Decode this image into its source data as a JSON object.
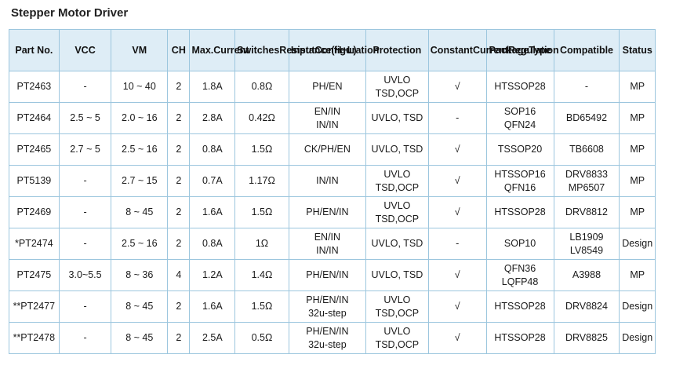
{
  "title": "Stepper Motor Driver",
  "headers": [
    [
      "Part No."
    ],
    [
      "VCC"
    ],
    [
      "VM"
    ],
    [
      "CH"
    ],
    [
      "Max.",
      "Current"
    ],
    [
      "Switches",
      "Resistance",
      "(H+L)"
    ],
    [
      "Input",
      "Configuration"
    ],
    [
      "Protection"
    ],
    [
      "Constant",
      "Current",
      "Regulation"
    ],
    [
      "Package",
      "Type"
    ],
    [
      "Compatible"
    ],
    [
      "Status"
    ]
  ],
  "rows": [
    [
      [
        "PT2463"
      ],
      [
        "-"
      ],
      [
        "10 ~ 40"
      ],
      [
        "2"
      ],
      [
        "1.8A"
      ],
      [
        "0.8Ω"
      ],
      [
        "PH/EN"
      ],
      [
        "UVLO",
        "TSD,OCP"
      ],
      [
        "√"
      ],
      [
        "HTSSOP28"
      ],
      [
        "-"
      ],
      [
        "MP"
      ]
    ],
    [
      [
        "PT2464"
      ],
      [
        "2.5 ~ 5"
      ],
      [
        "2.0 ~ 16"
      ],
      [
        "2"
      ],
      [
        "2.8A"
      ],
      [
        "0.42Ω"
      ],
      [
        "EN/IN",
        "IN/IN"
      ],
      [
        "UVLO, TSD"
      ],
      [
        "-"
      ],
      [
        "SOP16",
        "QFN24"
      ],
      [
        "BD65492"
      ],
      [
        "MP"
      ]
    ],
    [
      [
        "PT2465"
      ],
      [
        "2.7 ~ 5"
      ],
      [
        "2.5 ~ 16"
      ],
      [
        "2"
      ],
      [
        "0.8A"
      ],
      [
        "1.5Ω"
      ],
      [
        "CK/PH/EN"
      ],
      [
        "UVLO, TSD"
      ],
      [
        "√"
      ],
      [
        "TSSOP20"
      ],
      [
        "TB6608"
      ],
      [
        "MP"
      ]
    ],
    [
      [
        "PT5139"
      ],
      [
        "-"
      ],
      [
        "2.7 ~ 15"
      ],
      [
        "2"
      ],
      [
        "0.7A"
      ],
      [
        "1.17Ω"
      ],
      [
        "IN/IN"
      ],
      [
        "UVLO",
        "TSD,OCP"
      ],
      [
        "√"
      ],
      [
        "HTSSOP16",
        "QFN16"
      ],
      [
        "DRV8833",
        "MP6507"
      ],
      [
        "MP"
      ]
    ],
    [
      [
        "PT2469"
      ],
      [
        "-"
      ],
      [
        "8 ~ 45"
      ],
      [
        "2"
      ],
      [
        "1.6A"
      ],
      [
        "1.5Ω"
      ],
      [
        "PH/EN/IN"
      ],
      [
        "UVLO",
        "TSD,OCP"
      ],
      [
        "√"
      ],
      [
        "HTSSOP28"
      ],
      [
        "DRV8812"
      ],
      [
        "MP"
      ]
    ],
    [
      [
        "*PT2474"
      ],
      [
        "-"
      ],
      [
        "2.5 ~ 16"
      ],
      [
        "2"
      ],
      [
        "0.8A"
      ],
      [
        "1Ω"
      ],
      [
        "EN/IN",
        "IN/IN"
      ],
      [
        "UVLO, TSD"
      ],
      [
        "-"
      ],
      [
        "SOP10"
      ],
      [
        "LB1909",
        "LV8549"
      ],
      [
        "Design"
      ]
    ],
    [
      [
        "PT2475"
      ],
      [
        "3.0~5.5"
      ],
      [
        "8 ~ 36"
      ],
      [
        "4"
      ],
      [
        "1.2A"
      ],
      [
        "1.4Ω"
      ],
      [
        "PH/EN/IN"
      ],
      [
        "UVLO, TSD"
      ],
      [
        "√"
      ],
      [
        "QFN36",
        "LQFP48"
      ],
      [
        "A3988"
      ],
      [
        "MP"
      ]
    ],
    [
      [
        "**PT2477"
      ],
      [
        "-"
      ],
      [
        "8 ~ 45"
      ],
      [
        "2"
      ],
      [
        "1.6A"
      ],
      [
        "1.5Ω"
      ],
      [
        "PH/EN/IN",
        "32u-step"
      ],
      [
        "UVLO",
        "TSD,OCP"
      ],
      [
        "√"
      ],
      [
        "HTSSOP28"
      ],
      [
        "DRV8824"
      ],
      [
        "Design"
      ]
    ],
    [
      [
        "**PT2478"
      ],
      [
        "-"
      ],
      [
        "8 ~ 45"
      ],
      [
        "2"
      ],
      [
        "2.5A"
      ],
      [
        "0.5Ω"
      ],
      [
        "PH/EN/IN",
        "32u-step"
      ],
      [
        "UVLO",
        "TSD,OCP"
      ],
      [
        "√"
      ],
      [
        "HTSSOP28"
      ],
      [
        "DRV8825"
      ],
      [
        "Design"
      ]
    ]
  ],
  "colors": {
    "header_bg": "#deedf6",
    "border": "#9cc6de",
    "text": "#1a1a1a"
  }
}
